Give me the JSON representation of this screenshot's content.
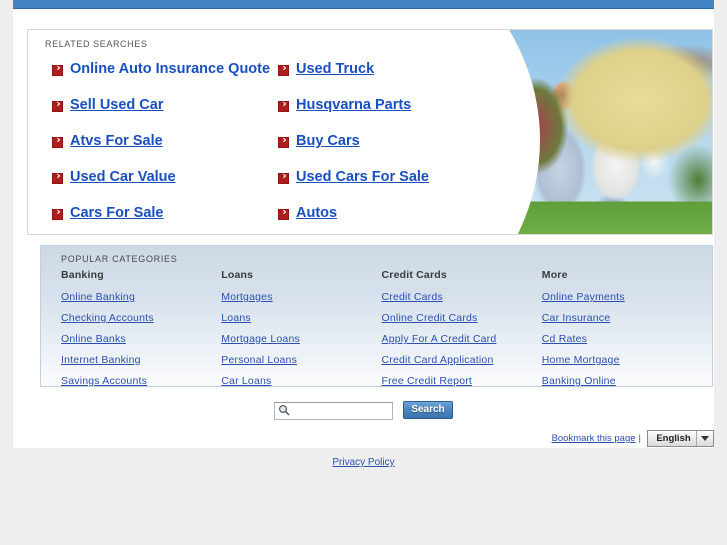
{
  "theme": {
    "topbar_color": "#4285c5",
    "link_color": "#1a4fbf",
    "bullet_color": "#b01d1d",
    "page_background": "#eeeeee",
    "categories_panel_top": "#ccd9e6"
  },
  "related_searches": {
    "heading": "RELATED SEARCHES",
    "bullet_icon": "red-arrow-bullet-icon",
    "left_column": [
      {
        "label": "Online Auto Insurance Quote",
        "underlined": false
      },
      {
        "label": "Sell Used Car",
        "underlined": true
      },
      {
        "label": "Atvs For Sale",
        "underlined": true
      },
      {
        "label": "Used Car Value",
        "underlined": true
      },
      {
        "label": "Cars For Sale",
        "underlined": true
      }
    ],
    "right_column": [
      {
        "label": "Used Truck",
        "underlined": true
      },
      {
        "label": "Husqvarna Parts",
        "underlined": true
      },
      {
        "label": "Buy Cars",
        "underlined": true
      },
      {
        "label": "Used Cars For Sale",
        "underlined": true
      },
      {
        "label": "Autos",
        "underlined": true
      }
    ],
    "hero_image_alt": "family-with-baby-in-front-of-house-photo"
  },
  "popular_categories": {
    "heading": "POPULAR CATEGORIES",
    "columns": [
      {
        "header": "Banking",
        "links": [
          "Online Banking",
          "Checking Accounts",
          "Online Banks",
          "Internet Banking",
          "Savings Accounts"
        ]
      },
      {
        "header": "Loans",
        "links": [
          "Mortgages",
          "Loans",
          "Mortgage Loans",
          "Personal Loans",
          "Car Loans"
        ]
      },
      {
        "header": "Credit Cards",
        "links": [
          "Credit Cards",
          "Online Credit Cards",
          "Apply For A Credit Card",
          "Credit Card Application",
          "Free Credit Report"
        ]
      },
      {
        "header": "More",
        "links": [
          "Online Payments",
          "Car Insurance",
          "Cd Rates",
          "Home Mortgage",
          "Banking Online"
        ]
      }
    ]
  },
  "search": {
    "value": "",
    "placeholder": "",
    "button_label": "Search",
    "icon": "magnifier-icon"
  },
  "bookmark": {
    "link_label": "Bookmark this page",
    "separator": "|"
  },
  "language": {
    "selected": "English",
    "options": [
      "English"
    ],
    "caret_icon": "chevron-down-icon"
  },
  "footer": {
    "privacy_label": "Privacy Policy"
  }
}
